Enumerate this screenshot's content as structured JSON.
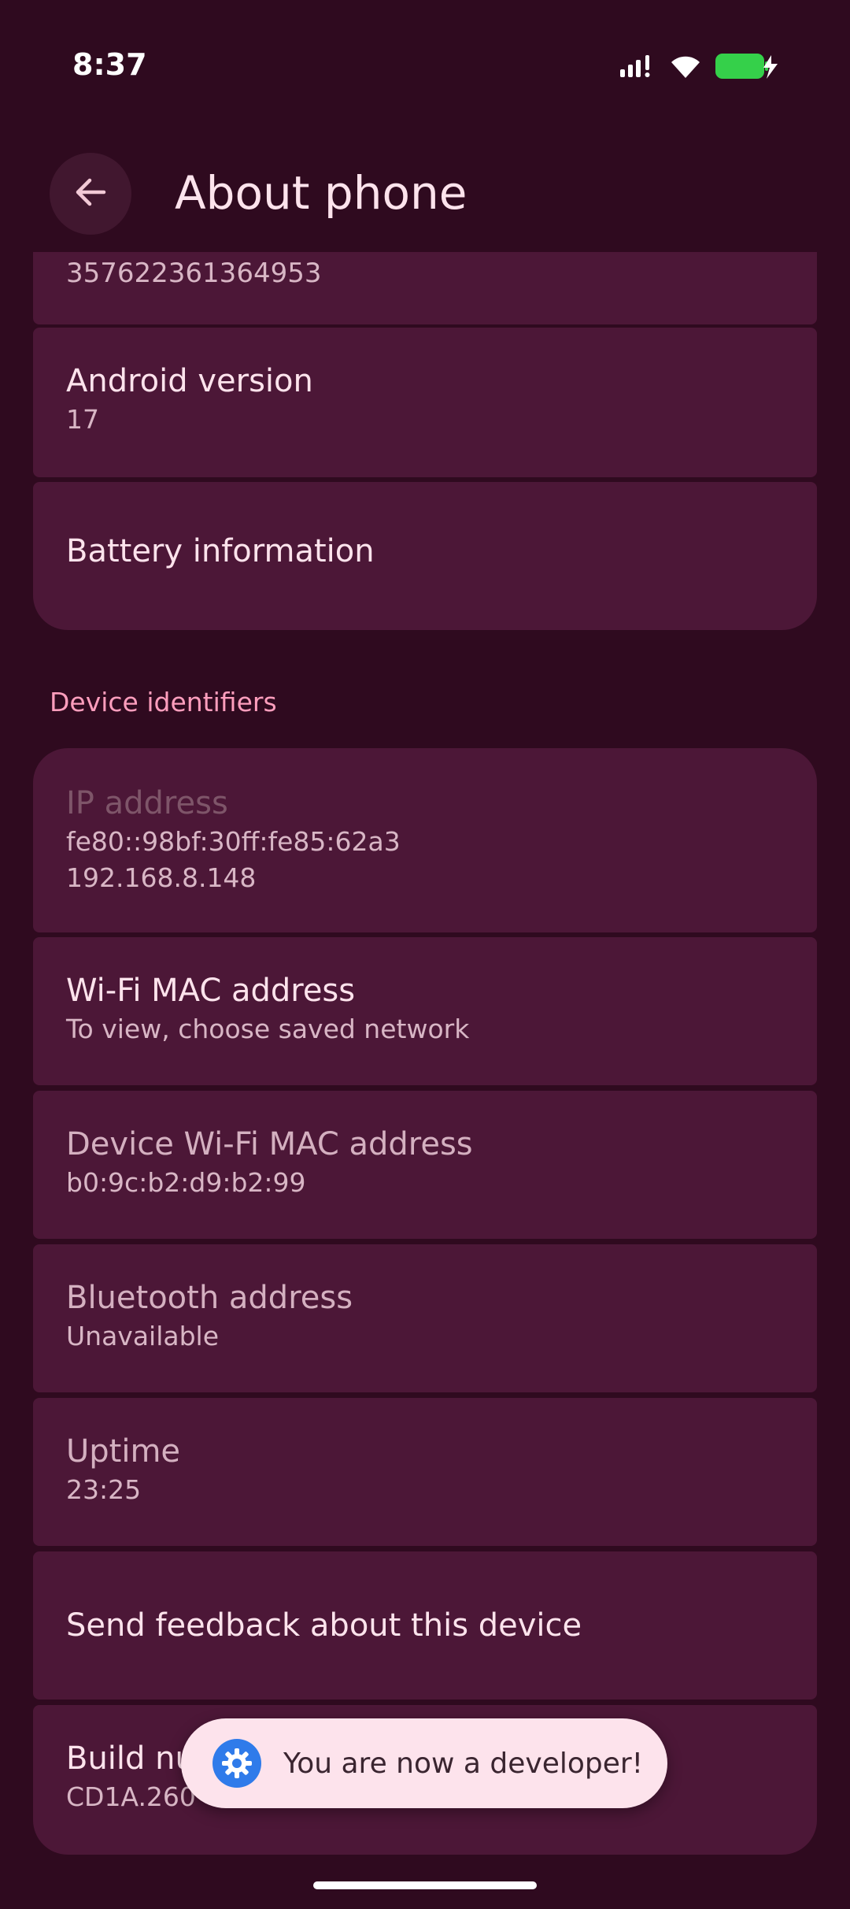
{
  "status_bar": {
    "time": "8:37",
    "battery_color": "#35d04a"
  },
  "header": {
    "title": "About phone"
  },
  "items": {
    "imei_value": "357622361364953",
    "android_version": {
      "title": "Android version",
      "value": "17"
    },
    "battery_information": {
      "title": "Battery information"
    }
  },
  "device_identifiers": {
    "section_label": "Device identifiers",
    "ip_address": {
      "title": "IP address",
      "value_line1": "fe80::98bf:30ff:fe85:62a3",
      "value_line2": "192.168.8.148"
    },
    "wifi_mac": {
      "title": "Wi-Fi MAC address",
      "value": "To view, choose saved network"
    },
    "device_wifi_mac": {
      "title": "Device Wi-Fi MAC address",
      "value": "b0:9c:b2:d9:b2:99"
    },
    "bluetooth": {
      "title": "Bluetooth address",
      "value": "Unavailable"
    },
    "uptime": {
      "title": "Uptime",
      "value": "23:25"
    },
    "send_feedback": {
      "title": "Send feedback about this device"
    },
    "build_number": {
      "title": "Build nu",
      "value": "CD1A.260"
    }
  },
  "toast": {
    "message": "You are now a developer!",
    "icon": "gear-icon"
  },
  "colors": {
    "background": "#2f0a1f",
    "card": "#4c1737",
    "accent": "#ff9ebd",
    "toast_bg": "#fde3ec"
  }
}
